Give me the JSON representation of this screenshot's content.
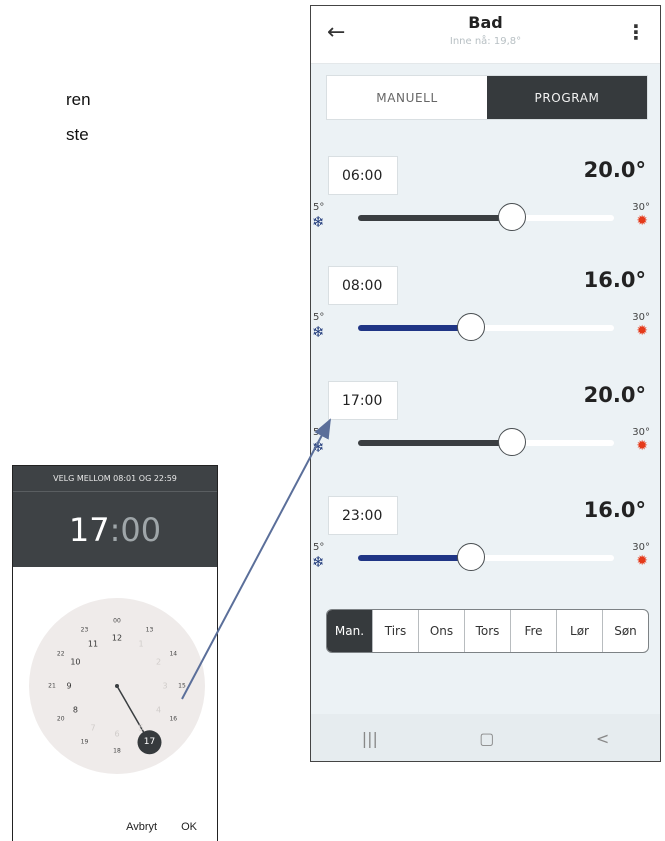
{
  "side_text": {
    "line1": "ren",
    "line2": "ste"
  },
  "appbar": {
    "title": "Bad",
    "subtitle": "Inne nå: 19,8°"
  },
  "mode_tabs": [
    {
      "label": "MANUELL",
      "active": false
    },
    {
      "label": "PROGRAM",
      "active": true
    }
  ],
  "programs": [
    {
      "time": "06:00",
      "temperature": "20.0°",
      "min_label": "5°",
      "max_label": "30°",
      "slider_fraction": 0.6
    },
    {
      "time": "08:00",
      "temperature": "16.0°",
      "min_label": "5°",
      "max_label": "30°",
      "slider_fraction": 0.44
    },
    {
      "time": "17:00",
      "temperature": "20.0°",
      "min_label": "5°",
      "max_label": "30°",
      "slider_fraction": 0.6
    },
    {
      "time": "23:00",
      "temperature": "16.0°",
      "min_label": "5°",
      "max_label": "30°",
      "slider_fraction": 0.44
    }
  ],
  "slider_colors": {
    "warm": "#3a3e41",
    "cool": "#1f3585"
  },
  "days": [
    {
      "label": "Man.",
      "selected": true
    },
    {
      "label": "Tirs",
      "selected": false
    },
    {
      "label": "Ons",
      "selected": false
    },
    {
      "label": "Tors",
      "selected": false
    },
    {
      "label": "Fre",
      "selected": false
    },
    {
      "label": "Lør",
      "selected": false
    },
    {
      "label": "Søn",
      "selected": false
    }
  ],
  "nav_icons": [
    "recent-apps-icon",
    "home-icon",
    "back-icon"
  ],
  "nav_glyphs": [
    "|||",
    "▢",
    "<"
  ],
  "picker": {
    "range_text": "VELG MELLOM 08:01 OG 22:59",
    "hours": "17",
    "separator": ":",
    "minutes": "00",
    "selected_hour": "17",
    "dial_hours": [
      "12",
      "1",
      "2",
      "3",
      "4",
      "5",
      "6",
      "7",
      "8",
      "9",
      "10",
      "11",
      "00",
      "13",
      "14",
      "15",
      "16",
      "17",
      "18",
      "19",
      "20",
      "21",
      "22",
      "23"
    ],
    "enabled_hours": [
      "8",
      "9",
      "10",
      "11",
      "12",
      "13",
      "14",
      "15",
      "16",
      "17",
      "18",
      "19",
      "20",
      "21",
      "22"
    ],
    "cancel_label": "Avbryt",
    "ok_label": "OK"
  }
}
